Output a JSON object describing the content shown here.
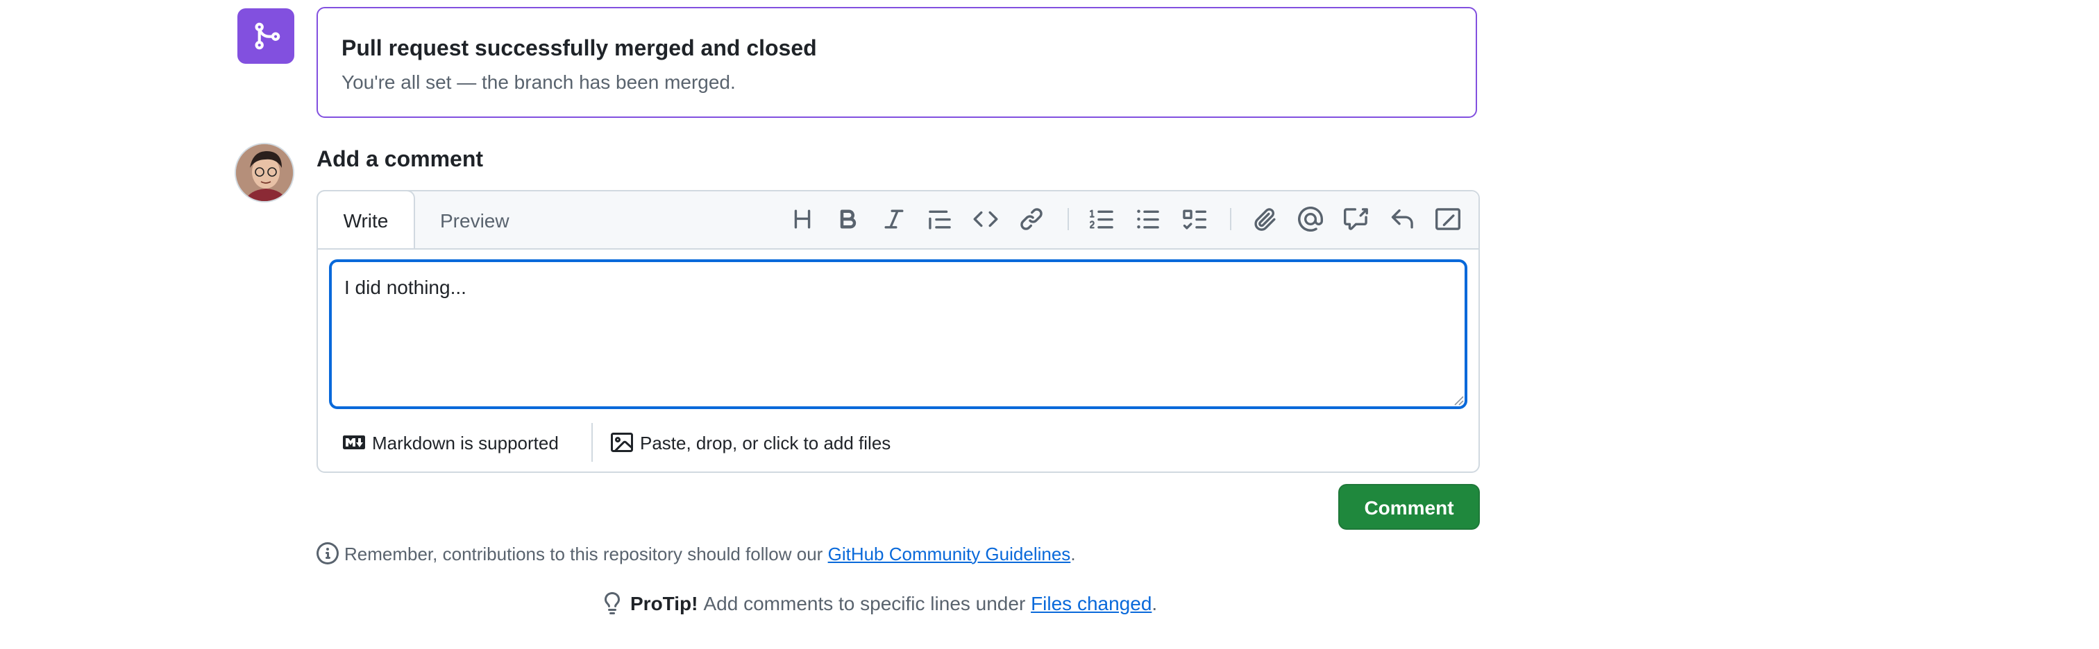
{
  "merged": {
    "title": "Pull request successfully merged and closed",
    "subtitle": "You're all set — the branch has been merged.",
    "icon": "git-merge-icon",
    "color": "#8250df"
  },
  "comment": {
    "heading": "Add a comment",
    "tabs": {
      "write": "Write",
      "preview": "Preview"
    },
    "toolbar": [
      "heading-icon",
      "bold-icon",
      "italic-icon",
      "quote-icon",
      "code-icon",
      "link-icon",
      "numbered-list-icon",
      "unordered-list-icon",
      "task-list-icon",
      "attach-icon",
      "mention-icon",
      "reference-icon",
      "saved-reply-icon",
      "slash-command-icon"
    ],
    "text": "I did nothing...",
    "markdown_note": "Markdown is supported",
    "paste_note": "Paste, drop, or click to add files",
    "submit_label": "Comment",
    "submit_color": "#1f883d",
    "focus_color": "#0969da"
  },
  "guidelines": {
    "text": "Remember, contributions to this repository should follow our",
    "link": "GitHub Community Guidelines",
    "end": "."
  },
  "protip": {
    "label": "ProTip!",
    "text": "Add comments to specific lines under",
    "link": "Files changed",
    "end": "."
  }
}
